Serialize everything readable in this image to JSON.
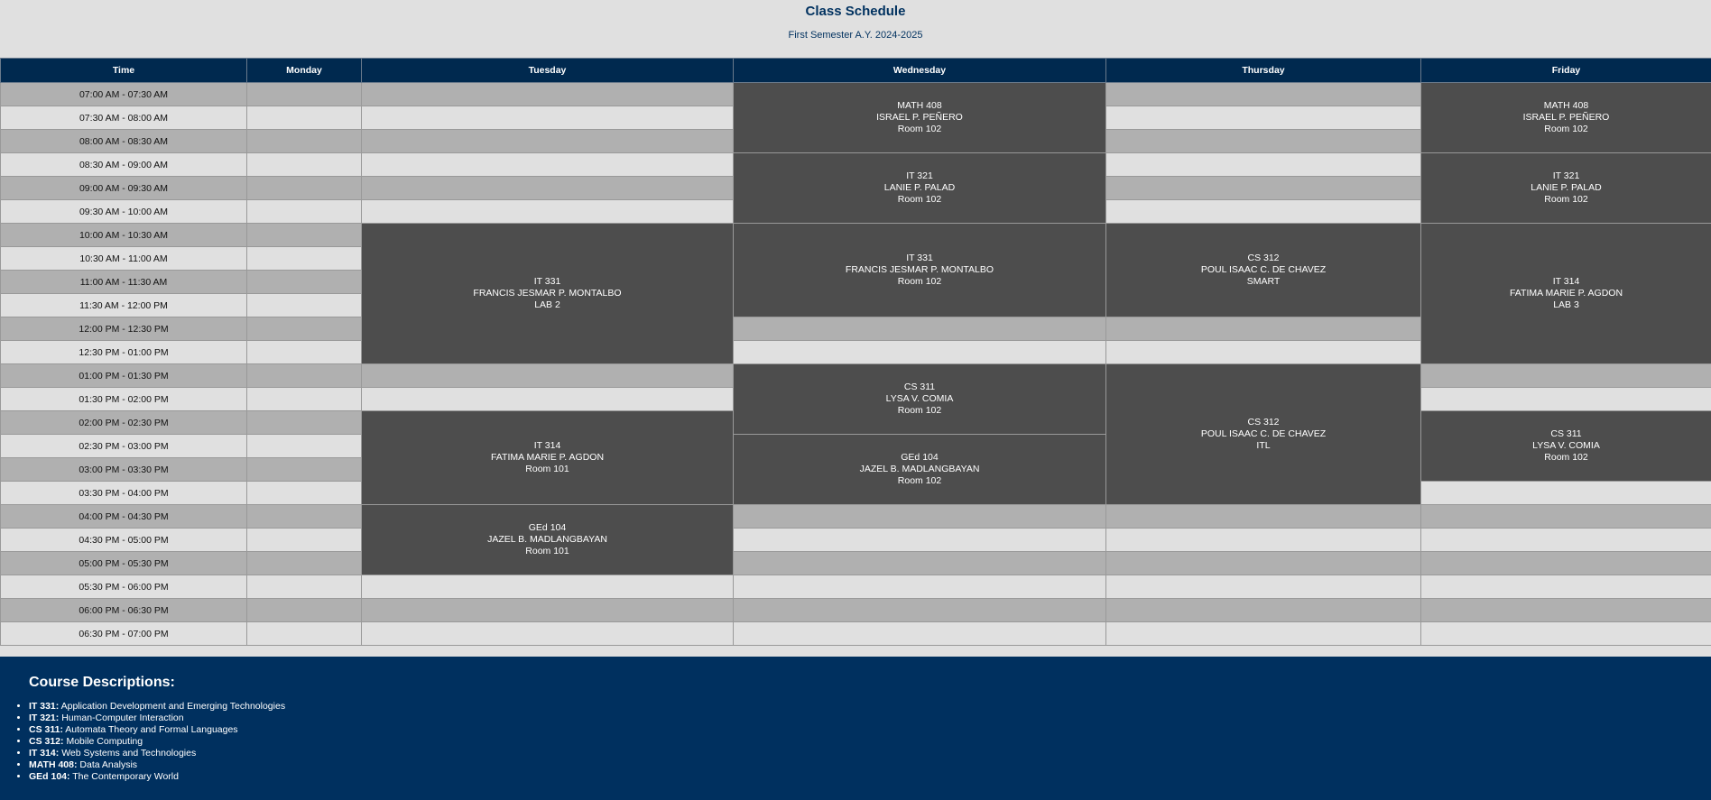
{
  "header": {
    "title": "Class Schedule",
    "subtitle": "First Semester A.Y. 2024-2025"
  },
  "columns": [
    "Time",
    "Monday",
    "Tuesday",
    "Wednesday",
    "Thursday",
    "Friday"
  ],
  "times": [
    "07:00 AM - 07:30 AM",
    "07:30 AM - 08:00 AM",
    "08:00 AM - 08:30 AM",
    "08:30 AM - 09:00 AM",
    "09:00 AM - 09:30 AM",
    "09:30 AM - 10:00 AM",
    "10:00 AM - 10:30 AM",
    "10:30 AM - 11:00 AM",
    "11:00 AM - 11:30 AM",
    "11:30 AM - 12:00 PM",
    "12:00 PM - 12:30 PM",
    "12:30 PM - 01:00 PM",
    "01:00 PM - 01:30 PM",
    "01:30 PM - 02:00 PM",
    "02:00 PM - 02:30 PM",
    "02:30 PM - 03:00 PM",
    "03:00 PM - 03:30 PM",
    "03:30 PM - 04:00 PM",
    "04:00 PM - 04:30 PM",
    "04:30 PM - 05:00 PM",
    "05:00 PM - 05:30 PM",
    "05:30 PM - 06:00 PM",
    "06:00 PM - 06:30 PM",
    "06:30 PM - 07:00 PM"
  ],
  "classes": [
    {
      "day": 3,
      "start": 0,
      "span": 3,
      "code": "MATH 408",
      "instructor": "ISRAEL P. PEÑERO",
      "room": "Room 102"
    },
    {
      "day": 5,
      "start": 0,
      "span": 3,
      "code": "MATH 408",
      "instructor": "ISRAEL P. PEÑERO",
      "room": "Room 102"
    },
    {
      "day": 3,
      "start": 3,
      "span": 3,
      "code": "IT 321",
      "instructor": "LANIE P. PALAD",
      "room": "Room 102"
    },
    {
      "day": 5,
      "start": 3,
      "span": 3,
      "code": "IT 321",
      "instructor": "LANIE P. PALAD",
      "room": "Room 102"
    },
    {
      "day": 2,
      "start": 6,
      "span": 6,
      "code": "IT 331",
      "instructor": "FRANCIS JESMAR P. MONTALBO",
      "room": "LAB 2"
    },
    {
      "day": 3,
      "start": 6,
      "span": 4,
      "code": "IT 331",
      "instructor": "FRANCIS JESMAR P. MONTALBO",
      "room": "Room 102"
    },
    {
      "day": 4,
      "start": 6,
      "span": 4,
      "code": "CS 312",
      "instructor": "POUL ISAAC C. DE CHAVEZ",
      "room": "SMART"
    },
    {
      "day": 5,
      "start": 6,
      "span": 6,
      "code": "IT 314",
      "instructor": "FATIMA MARIE P. AGDON",
      "room": "LAB 3"
    },
    {
      "day": 3,
      "start": 12,
      "span": 3,
      "code": "CS 311",
      "instructor": "LYSA V. COMIA",
      "room": "Room 102"
    },
    {
      "day": 4,
      "start": 12,
      "span": 6,
      "code": "CS 312",
      "instructor": "POUL ISAAC C. DE CHAVEZ",
      "room": "ITL"
    },
    {
      "day": 2,
      "start": 14,
      "span": 4,
      "code": "IT 314",
      "instructor": "FATIMA MARIE P. AGDON",
      "room": "Room 101"
    },
    {
      "day": 5,
      "start": 14,
      "span": 3,
      "code": "CS 311",
      "instructor": "LYSA V. COMIA",
      "room": "Room 102"
    },
    {
      "day": 3,
      "start": 15,
      "span": 3,
      "code": "GEd 104",
      "instructor": "JAZEL B. MADLANGBAYAN",
      "room": "Room 102"
    },
    {
      "day": 2,
      "start": 18,
      "span": 3,
      "code": "GEd 104",
      "instructor": "JAZEL B. MADLANGBAYAN",
      "room": "Room 101"
    }
  ],
  "courses": {
    "heading": "Course Descriptions:",
    "items": [
      {
        "code": "IT 331:",
        "name": "Application Development and Emerging Technologies"
      },
      {
        "code": "IT 321:",
        "name": "Human-Computer Interaction"
      },
      {
        "code": "CS 311:",
        "name": "Automata Theory and Formal Languages"
      },
      {
        "code": "CS 312:",
        "name": "Mobile Computing"
      },
      {
        "code": "IT 314:",
        "name": "Web Systems and Technologies"
      },
      {
        "code": "MATH 408:",
        "name": "Data Analysis"
      },
      {
        "code": "GEd 104:",
        "name": "The Contemporary World"
      }
    ]
  }
}
